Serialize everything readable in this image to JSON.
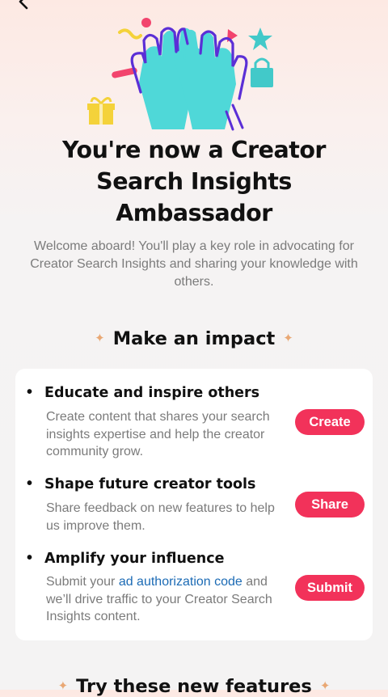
{
  "title": {
    "line1": "You're now a Creator",
    "line2": "Search Insights",
    "line3": "Ambassador"
  },
  "subtitle": "Welcome aboard! You'll play a key role in advocating for Creator Search Insights and sharing your knowledge with others.",
  "impact": {
    "heading": "Make an impact",
    "items": [
      {
        "title": "Educate and inspire others",
        "desc": "Create content that shares your search insights expertise and help the creator community grow.",
        "button": "Create"
      },
      {
        "title": "Shape future creator tools",
        "desc": "Share feedback on new features to help us improve them.",
        "button": "Share"
      },
      {
        "title": "Amplify your influence",
        "desc_before": "Submit your ",
        "desc_link": "ad authorization code",
        "desc_after": " and we’ll drive traffic to your Creator Search Insights content.",
        "button": "Submit"
      }
    ]
  },
  "next_section": {
    "heading": "Try these new features"
  },
  "icons": {
    "back": "back-arrow-icon",
    "sparkle": "sparkle-icon"
  },
  "colors": {
    "accent": "#f2325a",
    "link": "#1c6bb5",
    "hands": "#4fd8d8",
    "outline": "#5b2fd6"
  }
}
